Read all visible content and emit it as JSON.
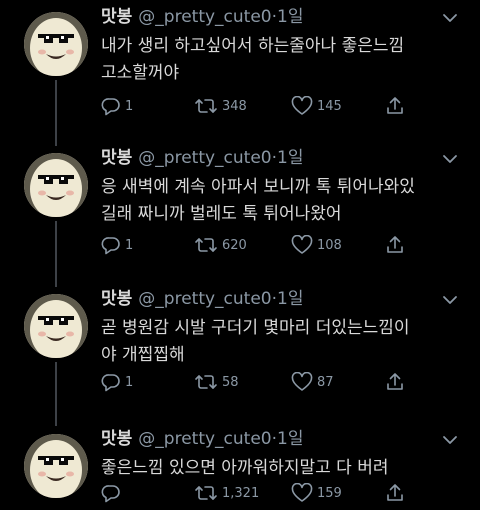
{
  "colors": {
    "background": "#000000",
    "text": "#d9d9d9",
    "secondary": "#8b98a5",
    "thread_line": "#3d4147"
  },
  "tweets": [
    {
      "name": "맛봉",
      "handle": "@_pretty_cute0",
      "dot": "·",
      "time": "1일",
      "text": "내가 생리 하고싶어서 하는줄아나 좋은느낌\n고소할꺼야",
      "replies": "1",
      "retweets": "348",
      "likes": "145"
    },
    {
      "name": "맛봉",
      "handle": "@_pretty_cute0",
      "dot": "·",
      "time": "1일",
      "text": "응 새벽에 계속 아파서 보니까 톡 튀어나와있\n길래 짜니까 벌레도 톡 튀어나왔어",
      "replies": "1",
      "retweets": "620",
      "likes": "108"
    },
    {
      "name": "맛봉",
      "handle": "@_pretty_cute0",
      "dot": "·",
      "time": "1일",
      "text": "곧 병원감 시발 구더기 몇마리 더있는느낌이\n야 개찝찝해",
      "replies": "1",
      "retweets": "58",
      "likes": "87"
    },
    {
      "name": "맛봉",
      "handle": "@_pretty_cute0",
      "dot": "·",
      "time": "1일",
      "text": "좋은느낌 있으면 아까워하지말고 다 버려",
      "replies": "",
      "retweets": "1,321",
      "likes": "159"
    }
  ],
  "icons": {
    "avatar": "meme-face-with-pixel-sunglasses",
    "reply": "reply-bubble-icon",
    "retweet": "retweet-icon",
    "like": "heart-icon",
    "share": "share-icon",
    "menu": "chevron-down-icon"
  }
}
